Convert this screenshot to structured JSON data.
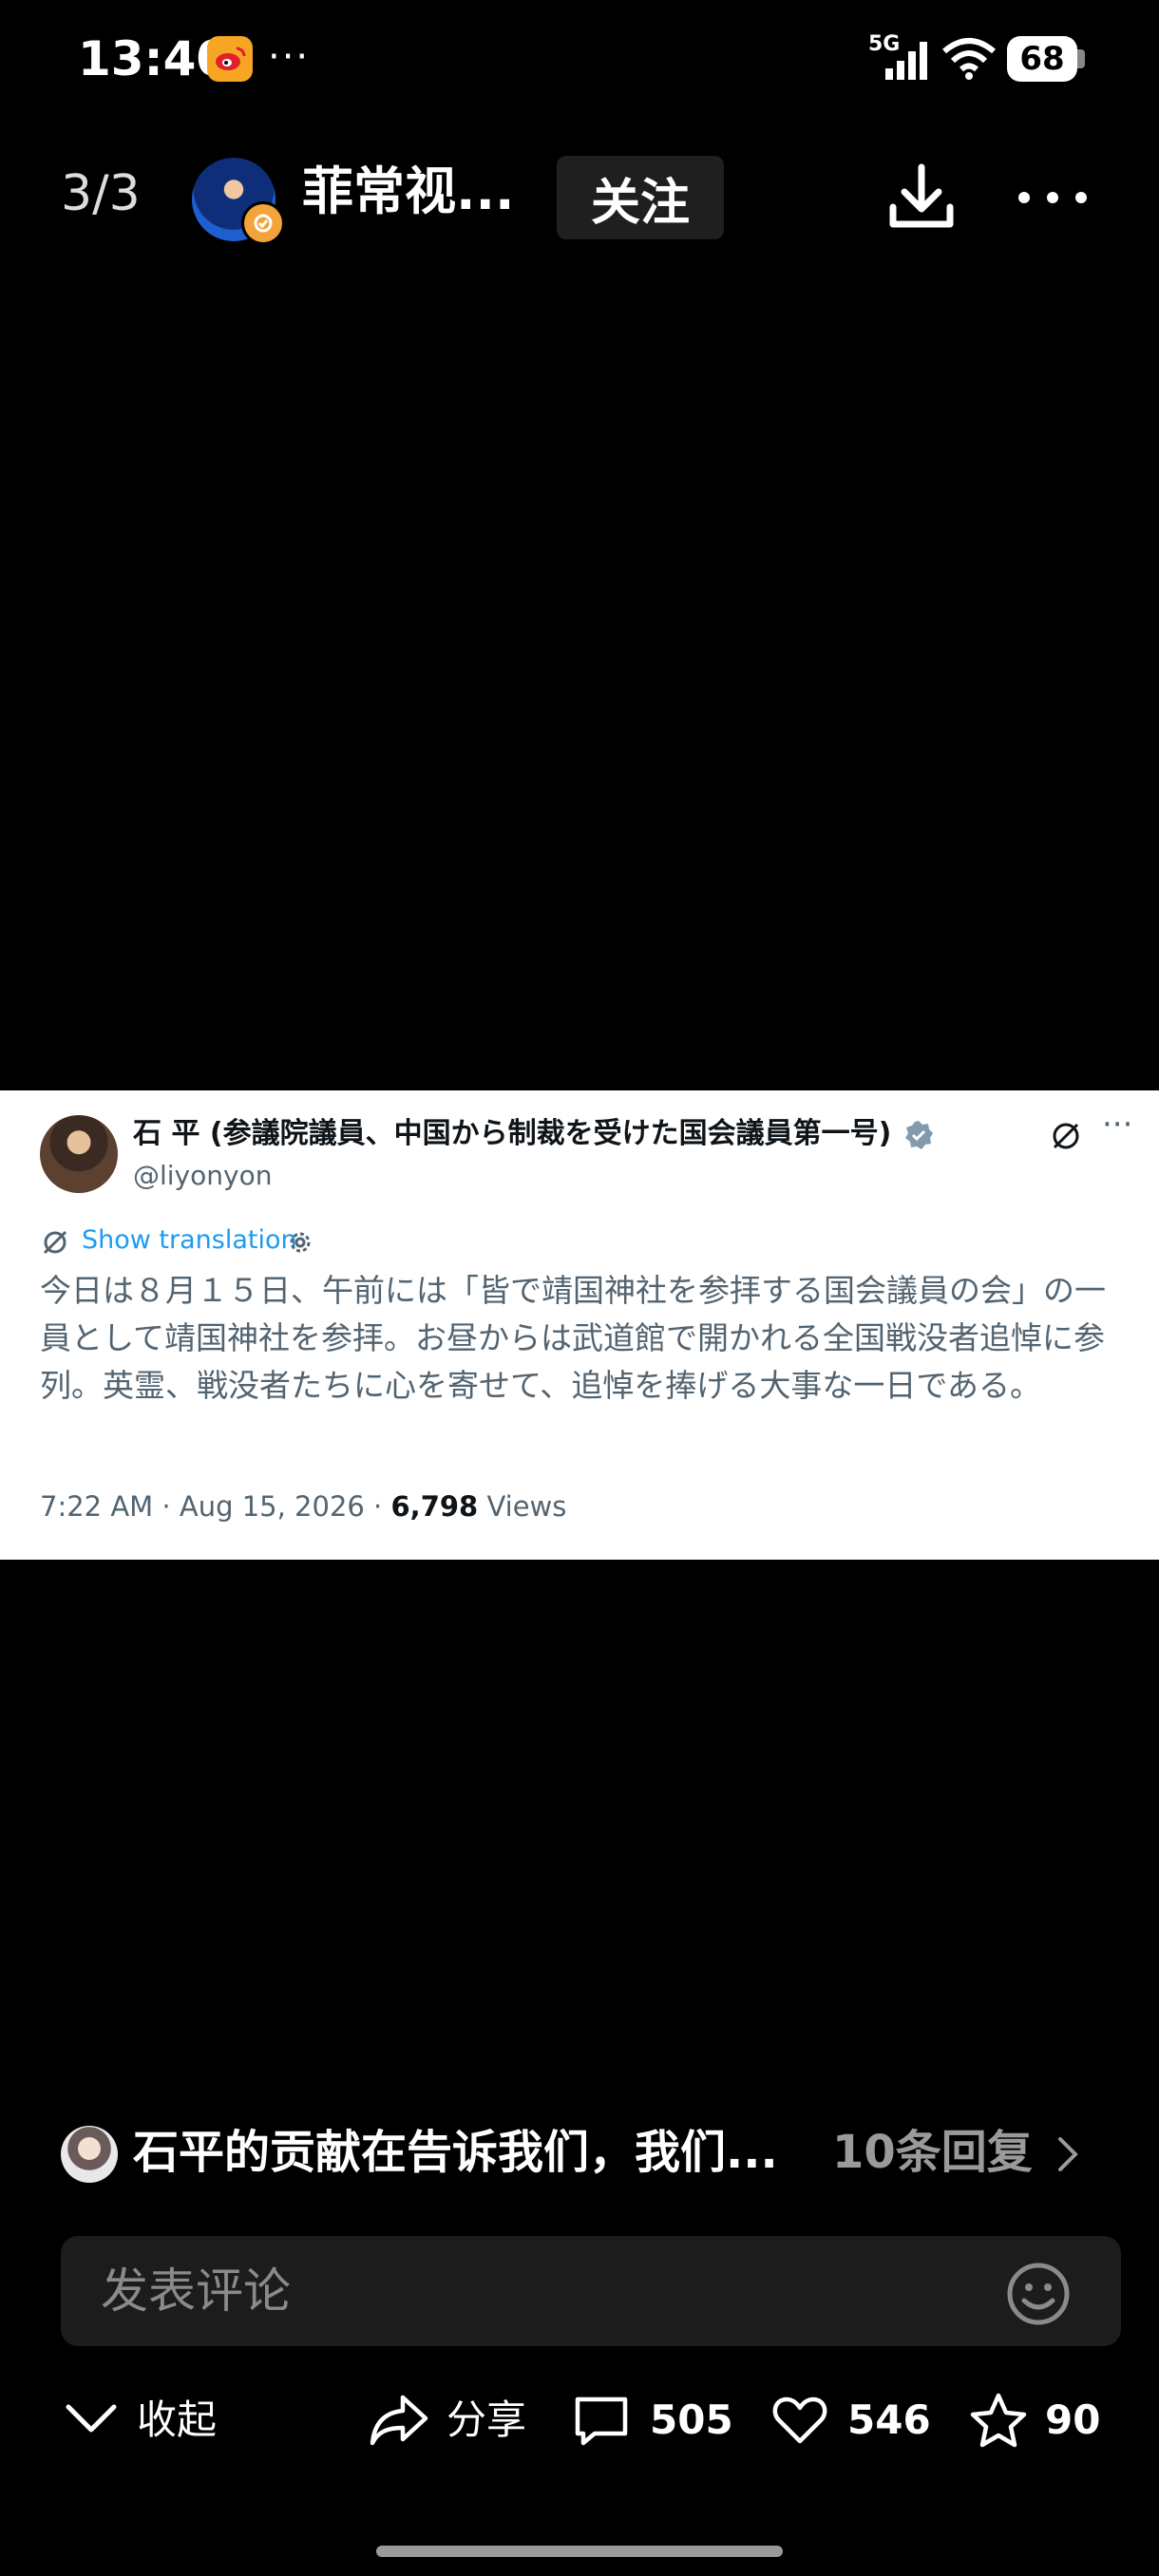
{
  "status_bar": {
    "time": "13:40",
    "dots": "···",
    "network": "5G",
    "battery": "68"
  },
  "header": {
    "page_counter": "3/3",
    "author_name": "菲常视...",
    "follow_label": "关注"
  },
  "tweet": {
    "display_name": "石 平 (参議院議員、中国から制裁を受けた国会議員第一号)",
    "handle": "@liyonyon",
    "show_translation": "Show translation",
    "text": "今日は８月１５日、午前には「皆で靖国神社を参拝する国会議員の会」の一員として靖国神社を参拝。お昼からは武道館で開かれる全国戦没者追悼に参列。英霊、戦没者たちに心を寄せて、追悼を捧げる大事な一日である。",
    "timestamp": "7:22 AM · Aug 15, 2026 · ",
    "views_count": "6,798",
    "views_label": " Views"
  },
  "comment_preview": {
    "text": "石平的贡献在告诉我们，我们...",
    "reply_count": "10条回复"
  },
  "comment_input": {
    "placeholder": "发表评论"
  },
  "bottom_bar": {
    "collapse_label": "收起",
    "share_label": "分享",
    "comment_count": "505",
    "like_count": "546",
    "favorite_count": "90"
  },
  "colors": {
    "background": "#000000",
    "link_blue": "#1d9bf0",
    "weibo_orange": "#f6a623"
  }
}
